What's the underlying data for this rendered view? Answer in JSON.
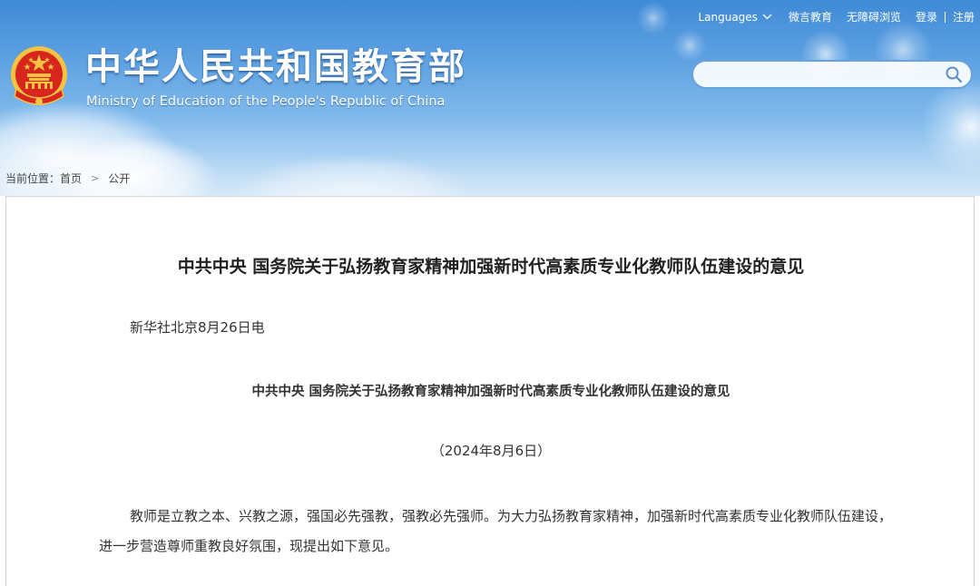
{
  "header": {
    "site_title": "中华人民共和国教育部",
    "site_subtitle": "Ministry of Education of the People's Republic of China",
    "top_links": {
      "languages": "Languages",
      "weibo": "微言教育",
      "accessibility": "无障碍浏览",
      "login": "登录",
      "register": "注册"
    },
    "search": {
      "value": "",
      "placeholder": ""
    },
    "breadcrumb": {
      "prefix": "当前位置：",
      "home": "首页",
      "current": "公开"
    }
  },
  "article": {
    "title": "中共中央 国务院关于弘扬教育家精神加强新时代高素质专业化教师队伍建设的意见",
    "dateline": "新华社北京8月26日电",
    "sub_title": "中共中央 国务院关于弘扬教育家精神加强新时代高素质专业化教师队伍建设的意见",
    "doc_date": "（2024年8月6日）",
    "paragraphs": [
      "教师是立教之本、兴教之源，强国必先强教，强教必先强师。为大力弘扬教育家精神，加强新时代高素质专业化教师队伍建设，进一步营造尊师重教良好氛围，现提出如下意见。"
    ]
  },
  "colors": {
    "header_top": "#3f8ad6",
    "header_bottom": "#d8e9f8",
    "emblem_red": "#d7261e",
    "emblem_gold": "#f5c242",
    "search_border": "#6aa2dc",
    "search_icon": "#5b8fc8",
    "card_border": "#d6d6d6",
    "text": "#333333"
  },
  "icons": {
    "emblem": "national-emblem-icon",
    "languages_arrow": "chevron-down-icon",
    "search": "search-icon",
    "breadcrumb_arrow": "chevron-right-icon"
  }
}
